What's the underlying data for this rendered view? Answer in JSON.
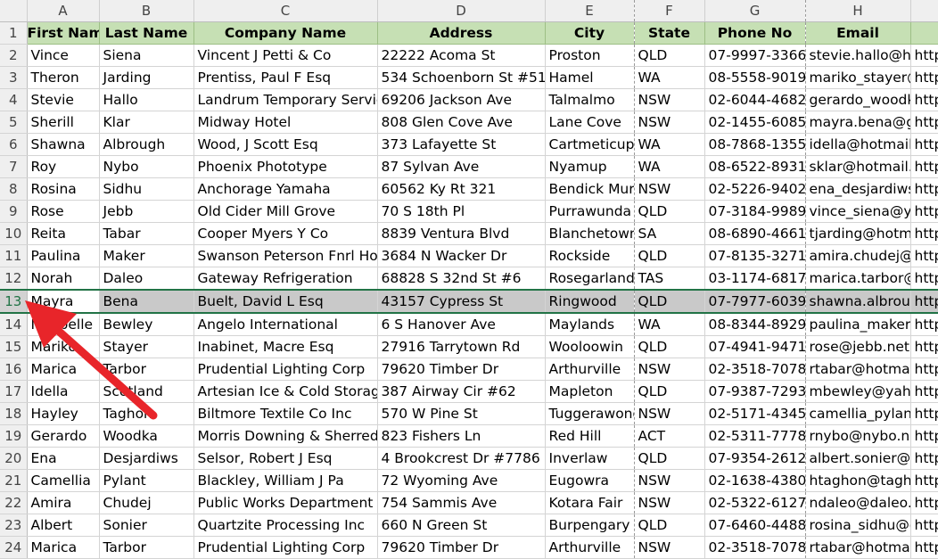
{
  "spreadsheet": {
    "column_letters": [
      "A",
      "B",
      "C",
      "D",
      "E",
      "F",
      "G",
      "H",
      ""
    ],
    "headers": [
      "First Name",
      "Last Name",
      "Company Name",
      "Address",
      "City",
      "State",
      "Phone No",
      "Email",
      ""
    ],
    "selected_row": 13,
    "rows": [
      {
        "n": "2",
        "cells": [
          "Vince",
          "Siena",
          "Vincent J Petti & Co",
          "22222 Acoma St",
          "Proston",
          "QLD",
          "07-9997-3366",
          "stevie.hallo@ho",
          "http"
        ]
      },
      {
        "n": "3",
        "cells": [
          "Theron",
          "Jarding",
          "Prentiss, Paul F Esq",
          "534 Schoenborn St #51",
          "Hamel",
          "WA",
          "08-5558-9019",
          "mariko_stayer@",
          "http"
        ]
      },
      {
        "n": "4",
        "cells": [
          "Stevie",
          "Hallo",
          "Landrum Temporary Services",
          "69206 Jackson Ave",
          "Talmalmo",
          "NSW",
          "02-6044-4682",
          "gerardo_woodk",
          "http"
        ]
      },
      {
        "n": "5",
        "cells": [
          "Sherill",
          "Klar",
          "Midway Hotel",
          "808 Glen Cove Ave",
          "Lane Cove",
          "NSW",
          "02-1455-6085",
          "mayra.bena@gr",
          "http"
        ]
      },
      {
        "n": "6",
        "cells": [
          "Shawna",
          "Albrough",
          "Wood, J Scott Esq",
          "373 Lafayette St",
          "Cartmeticup",
          "WA",
          "08-7868-1355",
          "idella@hotmail.",
          "http"
        ]
      },
      {
        "n": "7",
        "cells": [
          "Roy",
          "Nybo",
          "Phoenix Phototype",
          "87 Sylvan Ave",
          "Nyamup",
          "WA",
          "08-6522-8931",
          "sklar@hotmail.c",
          "http"
        ]
      },
      {
        "n": "8",
        "cells": [
          "Rosina",
          "Sidhu",
          "Anchorage Yamaha",
          "60562 Ky Rt 321",
          "Bendick Murrell",
          "NSW",
          "02-5226-9402",
          "ena_desjardiws",
          "http"
        ]
      },
      {
        "n": "9",
        "cells": [
          "Rose",
          "Jebb",
          "Old Cider Mill Grove",
          "70 S 18th Pl",
          "Purrawunda",
          "QLD",
          "07-3184-9989",
          "vince_siena@ya",
          "http"
        ]
      },
      {
        "n": "10",
        "cells": [
          "Reita",
          "Tabar",
          "Cooper Myers Y Co",
          "8839 Ventura Blvd",
          "Blanchetown",
          "SA",
          "08-6890-4661",
          "tjarding@hotma",
          "http"
        ]
      },
      {
        "n": "11",
        "cells": [
          "Paulina",
          "Maker",
          "Swanson Peterson Fnrl Home",
          "3684 N Wacker Dr",
          "Rockside",
          "QLD",
          "07-8135-3271",
          "amira.chudej@",
          "http"
        ]
      },
      {
        "n": "12",
        "cells": [
          "Norah",
          "Daleo",
          "Gateway Refrigeration",
          "68828 S 32nd St #6",
          "Rosegarland",
          "TAS",
          "03-1174-6817",
          "marica.tarbor@",
          "http"
        ]
      },
      {
        "n": "13",
        "cells": [
          "Mayra",
          "Bena",
          "Buelt, David L Esq",
          "43157 Cypress St",
          "Ringwood",
          "QLD",
          "07-7977-6039",
          "shawna.albroug",
          "http"
        ]
      },
      {
        "n": "14",
        "cells": [
          "Maybelle",
          "Bewley",
          "Angelo International",
          "6 S Hanover Ave",
          "Maylands",
          "WA",
          "08-8344-8929",
          "paulina_maker@",
          "http"
        ]
      },
      {
        "n": "15",
        "cells": [
          "Mariko",
          "Stayer",
          "Inabinet, Macre Esq",
          "27916 Tarrytown Rd",
          "Wooloowin",
          "QLD",
          "07-4941-9471",
          "rose@jebb.net.",
          "http"
        ]
      },
      {
        "n": "16",
        "cells": [
          "Marica",
          "Tarbor",
          "Prudential Lighting Corp",
          "79620 Timber Dr",
          "Arthurville",
          "NSW",
          "02-3518-7078",
          "rtabar@hotmai",
          "http"
        ]
      },
      {
        "n": "17",
        "cells": [
          "Idella",
          "Scotland",
          "Artesian Ice & Cold Storage Co",
          "387 Airway Cir #62",
          "Mapleton",
          "QLD",
          "07-9387-7293",
          "mbewley@yaho",
          "http"
        ]
      },
      {
        "n": "18",
        "cells": [
          "Hayley",
          "Taghon",
          "Biltmore Textile Co Inc",
          "570 W Pine St",
          "Tuggerawong",
          "NSW",
          "02-5171-4345",
          "camellia_pylant",
          "http"
        ]
      },
      {
        "n": "19",
        "cells": [
          "Gerardo",
          "Woodka",
          "Morris Downing & Sherred",
          "823 Fishers Ln",
          "Red Hill",
          "ACT",
          "02-5311-7778",
          "rnybo@nybo.ne",
          "http"
        ]
      },
      {
        "n": "20",
        "cells": [
          "Ena",
          "Desjardiws",
          "Selsor, Robert J Esq",
          "4 Brookcrest Dr #7786",
          "Inverlaw",
          "QLD",
          "07-9354-2612",
          "albert.sonier@g",
          "http"
        ]
      },
      {
        "n": "21",
        "cells": [
          "Camellia",
          "Pylant",
          "Blackley, William J Pa",
          "72 Wyoming Ave",
          "Eugowra",
          "NSW",
          "02-1638-4380",
          "htaghon@tagho",
          "http"
        ]
      },
      {
        "n": "22",
        "cells": [
          "Amira",
          "Chudej",
          "Public Works Department",
          "754 Sammis Ave",
          "Kotara Fair",
          "NSW",
          "02-5322-6127",
          "ndaleo@daleo.",
          "http"
        ]
      },
      {
        "n": "23",
        "cells": [
          "Albert",
          "Sonier",
          "Quartzite Processing Inc",
          "660 N Green St",
          "Burpengary",
          "QLD",
          "07-6460-4488",
          "rosina_sidhu@g",
          "http"
        ]
      },
      {
        "n": "24",
        "cells": [
          "Marica",
          "Tarbor",
          "Prudential Lighting Corp",
          "79620 Timber Dr",
          "Arthurville",
          "NSW",
          "02-3518-7078",
          "rtabar@hotmai",
          "http"
        ]
      }
    ]
  },
  "colors": {
    "header_fill": "#c6e0b4",
    "selection_border": "#217346",
    "selected_row_fill": "#c9c9c9",
    "arrow": "#e8252a"
  },
  "annotation": {
    "icon": "red-arrow-icon"
  }
}
